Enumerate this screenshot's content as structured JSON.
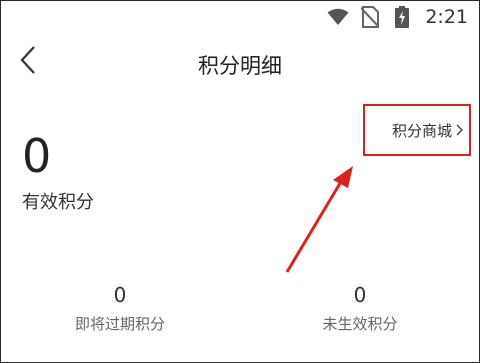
{
  "status_bar": {
    "time": "2:21",
    "icons": [
      "wifi-icon",
      "no-sim-icon",
      "battery-charging-icon"
    ]
  },
  "header": {
    "back_icon": "chevron-left-icon",
    "title": "积分明细"
  },
  "mall_link": {
    "label": "积分商城",
    "chevron": "chevron-right-icon"
  },
  "valid_points": {
    "value": "0",
    "label": "有效积分"
  },
  "stats": {
    "expiring": {
      "value": "0",
      "label": "即将过期积分"
    },
    "pending": {
      "value": "0",
      "label": "未生效积分"
    }
  },
  "colors": {
    "annotation": "#e0201c",
    "text_primary": "#222222",
    "text_secondary": "#666666"
  }
}
